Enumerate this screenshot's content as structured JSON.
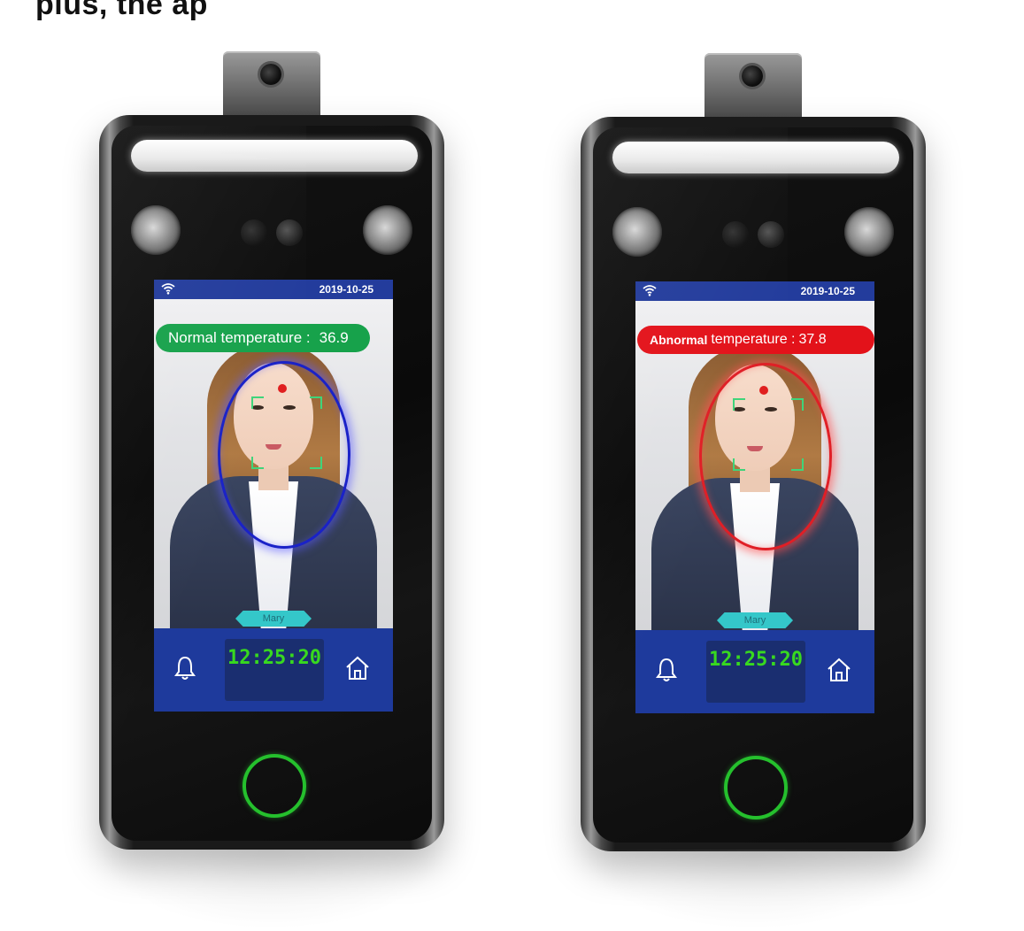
{
  "page": {
    "heading_fragment": "plus, the ap"
  },
  "devices": [
    {
      "date": "2019-10-25",
      "temperature_label": "Normal temperature :",
      "temperature_value": "36.9",
      "status": "normal",
      "name_tag": "Mary",
      "time": "12:25:20",
      "ring_color": "#1a22c8",
      "pill_color": "#17a24b"
    },
    {
      "date": "2019-10-25",
      "temperature_label_bold": "Abnormal",
      "temperature_label": "temperature :",
      "temperature_value": "37.8",
      "status": "abnormal",
      "name_tag": "Mary",
      "time": "12:25:20",
      "ring_color": "#e01f26",
      "pill_color": "#e3121a"
    }
  ],
  "icons": {
    "wifi": "wifi-icon",
    "bell": "bell-icon",
    "home": "home-icon",
    "fingerprint": "fingerprint-ring-icon"
  },
  "colors": {
    "clock_text": "#38d91f",
    "status_bar": "#233c9c",
    "bottom_bar": "#1e3a9c",
    "face_brackets": "#3fd47a"
  }
}
